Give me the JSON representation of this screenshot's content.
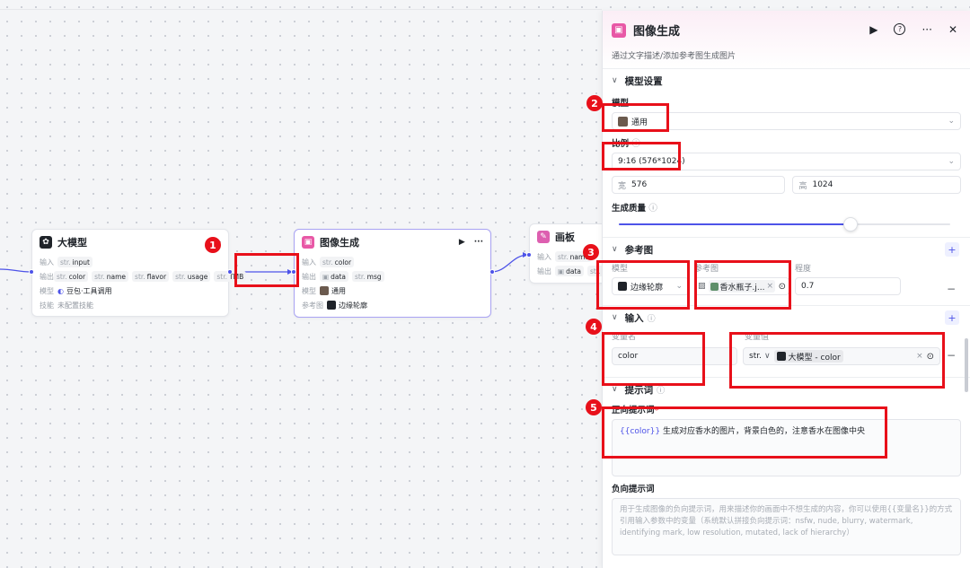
{
  "canvas": {
    "node_llm": {
      "title": "大模型",
      "input_label": "输入",
      "input_chip_type": "str.",
      "input_chip_name": "input",
      "output_label": "输出",
      "outputs": [
        {
          "type": "str.",
          "name": "color"
        },
        {
          "type": "str.",
          "name": "name"
        },
        {
          "type": "str.",
          "name": "flavor"
        },
        {
          "type": "str.",
          "name": "usage"
        },
        {
          "type": "str.",
          "name": "TMB"
        }
      ],
      "model_label": "模型",
      "model_value": "豆包·工具调用",
      "skill_label": "技能",
      "skill_value": "未配置技能"
    },
    "node_image": {
      "title": "图像生成",
      "input_label": "输入",
      "input_chip_type": "str.",
      "input_chip_name": "color",
      "output_label": "输出",
      "outputs": [
        {
          "type": "▣",
          "name": "data"
        },
        {
          "type": "str.",
          "name": "msg"
        }
      ],
      "model_label": "模型",
      "model_value": "通用",
      "ref_label": "参考图",
      "ref_value": "边缘轮廓"
    },
    "node_board": {
      "title": "画板",
      "input_label": "输入",
      "input_chip_type": "str.",
      "input_chip_name": "name",
      "output_label": "输出",
      "output_chip_name": "data",
      "output_chip_type2": "str."
    },
    "badges": [
      "1",
      "2",
      "3",
      "4",
      "5"
    ]
  },
  "panel": {
    "title": "图像生成",
    "description": "通过文字描述/添加参考图生成图片",
    "model_section": {
      "title": "模型设置",
      "model_label": "模型",
      "model_value": "通用",
      "ratio_label": "比例",
      "ratio_value": "9:16 (576*1024)",
      "width_label": "宽",
      "width_value": "576",
      "height_label": "高",
      "height_value": "1024",
      "quality_label": "生成质量",
      "quality_level": 0.7
    },
    "ref_section": {
      "title": "参考图",
      "col_model": "模型",
      "col_ref": "参考图",
      "col_degree": "程度",
      "model_value": "边缘轮廓",
      "ref_value": "香水瓶子.j...",
      "degree_value": "0.7"
    },
    "input_section": {
      "title": "输入",
      "col_name": "变量名",
      "col_value": "变量值",
      "name_value": "color",
      "type_value": "str.",
      "var_value": "大模型 - color"
    },
    "prompt_section": {
      "title": "提示词",
      "positive_label": "正向提示词",
      "positive_tag": "{{color}}",
      "positive_text": " 生成对应香水的图片，背景白色的，注意香水在图像中央",
      "negative_label": "负向提示词",
      "negative_placeholder": "用于生成图像的负向提示词，用来描述你的画面中不想生成的内容，你可以使用{{变量名}}的方式引用输入参数中的变量（系统默认拼接负向提示词：nsfw, nude, blurry, watermark, identifying mark, low resolution, mutated, lack of hierarchy）"
    }
  },
  "colors": {
    "accent": "#4d53e8",
    "annotation_red": "#e8101a",
    "image_node_pink": "#e858a6"
  }
}
